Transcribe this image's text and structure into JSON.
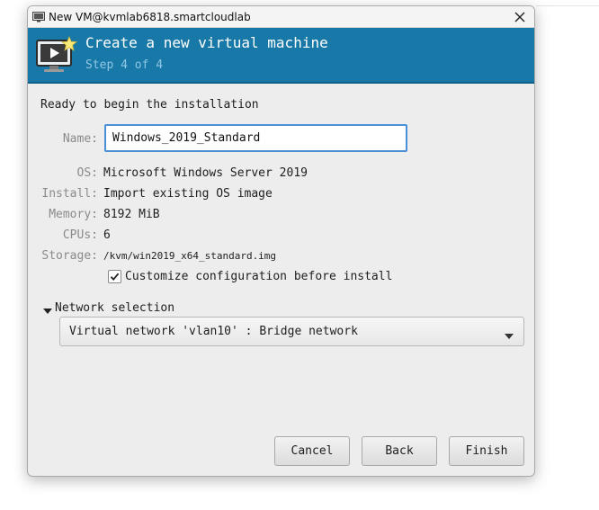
{
  "window": {
    "title": "New VM@kvmlab6818.smartcloudlab"
  },
  "banner": {
    "heading": "Create a new virtual machine",
    "step": "Step 4 of 4",
    "icon": "monitor-play-icon",
    "accent_color": "#1878a8"
  },
  "summary": {
    "ready_text": "Ready to begin the installation",
    "name_label": "Name:",
    "name_value": "Windows_2019_Standard",
    "os_label": "OS:",
    "os_value": "Microsoft Windows Server 2019",
    "install_label": "Install:",
    "install_value": "Import existing OS image",
    "memory_label": "Memory:",
    "memory_value": "8192 MiB",
    "cpus_label": "CPUs:",
    "cpus_value": "6",
    "storage_label": "Storage:",
    "storage_value": "/kvm/win2019_x64_standard.img"
  },
  "customize": {
    "label": "Customize configuration before install",
    "checked": true
  },
  "network": {
    "section_label": "Network selection",
    "expanded": true,
    "selected": "Virtual network 'vlan10' : Bridge network"
  },
  "buttons": {
    "cancel": "Cancel",
    "back": "Back",
    "finish": "Finish"
  }
}
